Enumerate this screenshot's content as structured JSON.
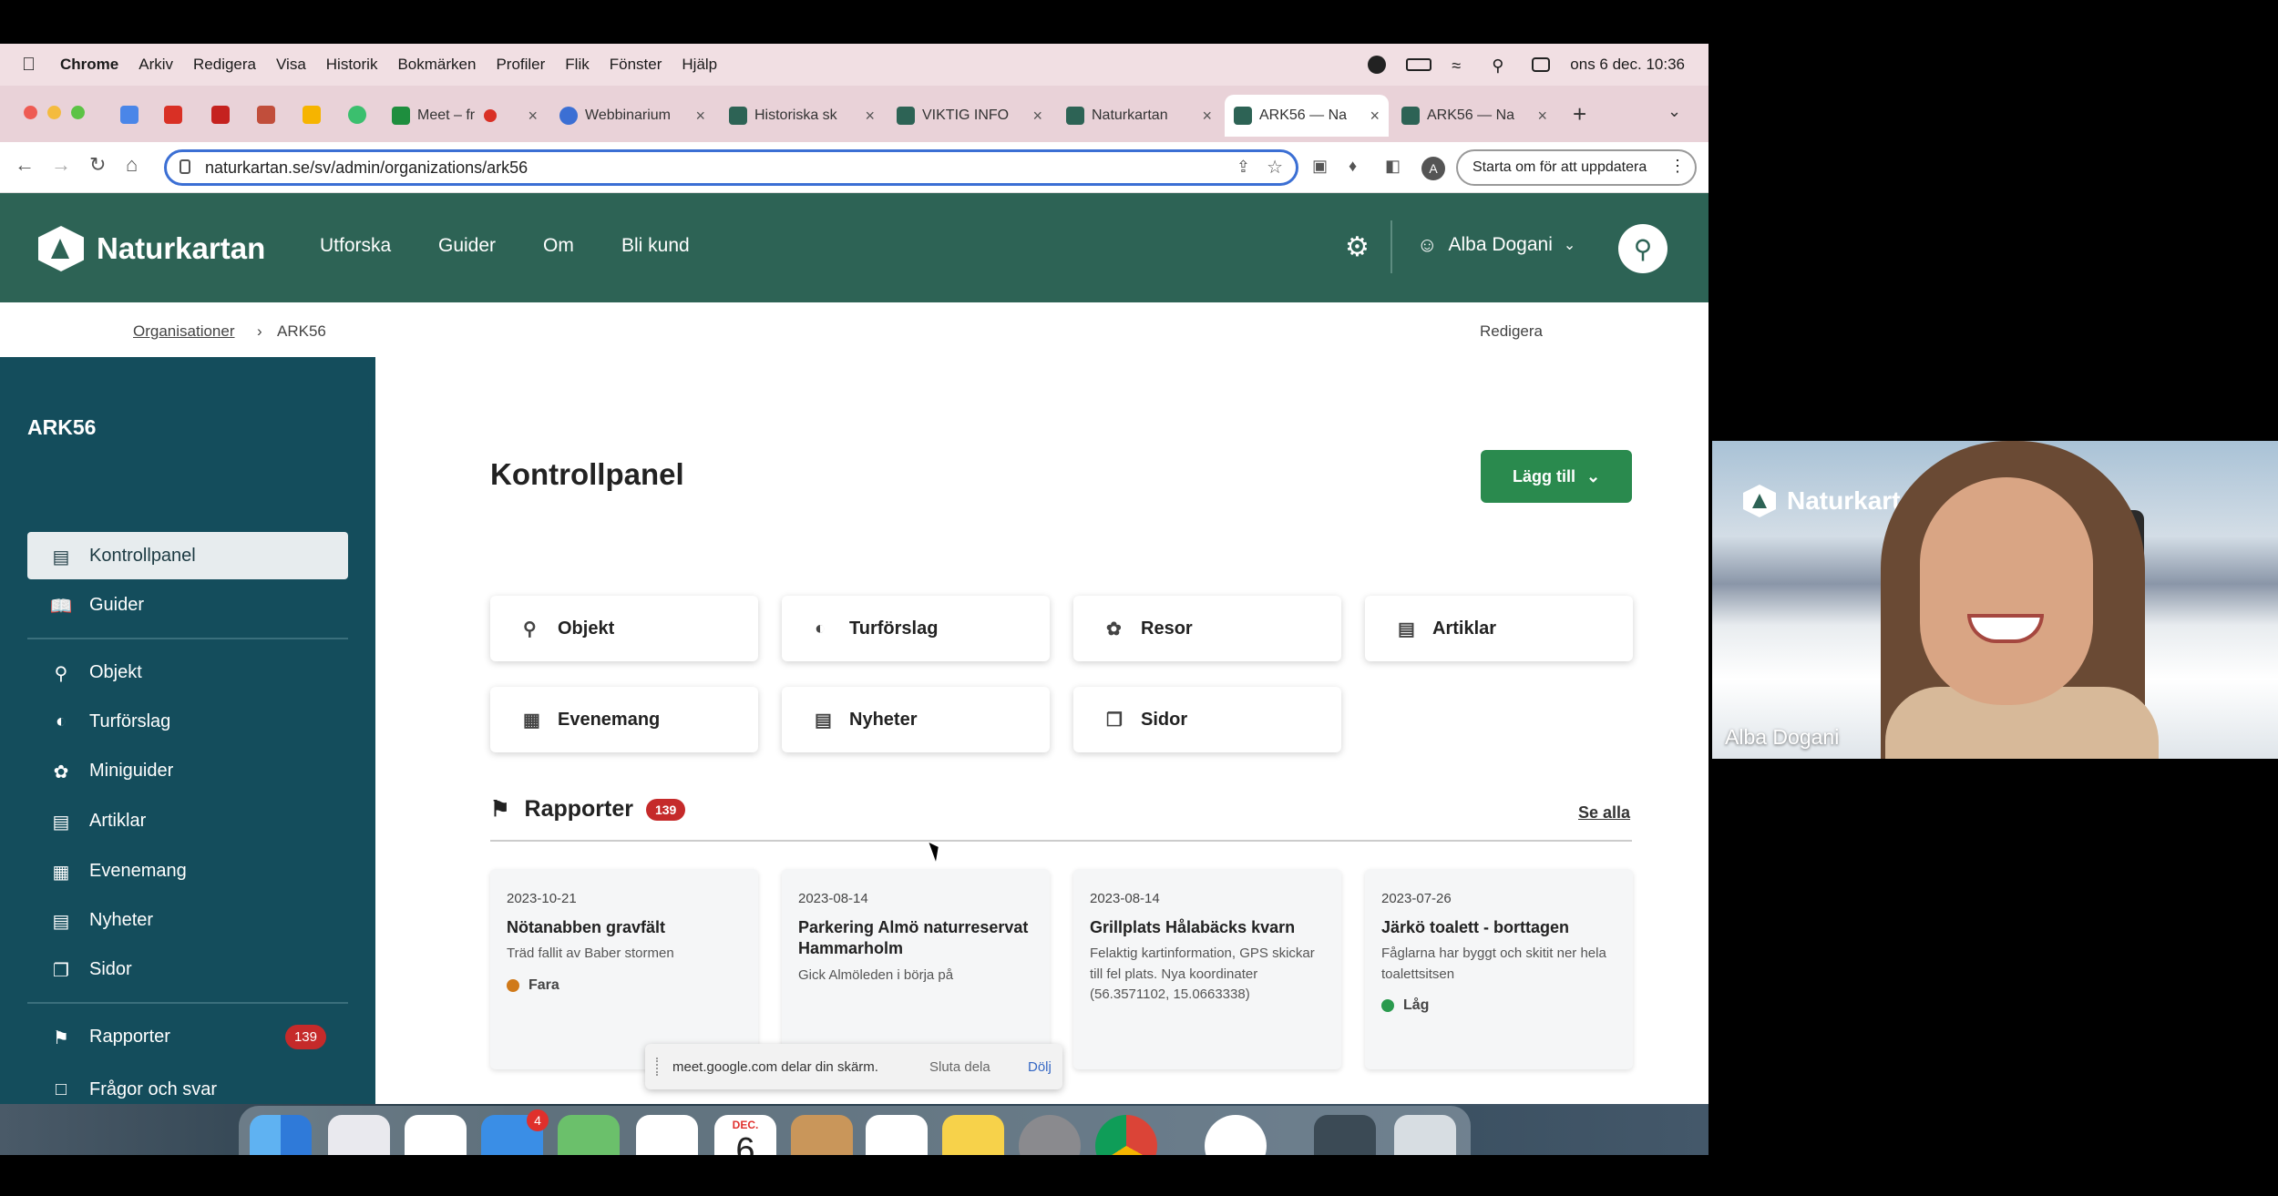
{
  "menubar": {
    "app": "Chrome",
    "items": [
      "Arkiv",
      "Redigera",
      "Visa",
      "Historik",
      "Bokmärken",
      "Profiler",
      "Flik",
      "Fönster",
      "Hjälp"
    ],
    "datetime": "ons 6 dec. 10:36"
  },
  "tabs": [
    {
      "label": "Meet – fr",
      "color": "#1e8e3e"
    },
    {
      "label": "Webbinarium",
      "color": "#3b6fd4"
    },
    {
      "label": "Historiska sk",
      "color": "#2d6355"
    },
    {
      "label": "VIKTIG INFO",
      "color": "#2d6355"
    },
    {
      "label": "Naturkartan",
      "color": "#2d6355"
    },
    {
      "label": "ARK56 — Na",
      "color": "#2d6355"
    },
    {
      "label": "ARK56 — Na",
      "color": "#2d6355"
    }
  ],
  "toolbar": {
    "url": "naturkartan.se/sv/admin/organizations/ark56",
    "update_label": "Starta om för att uppdatera"
  },
  "site": {
    "logo": "Naturkartan",
    "nav": [
      "Utforska",
      "Guider",
      "Om",
      "Bli kund"
    ],
    "user": "Alba Dogani"
  },
  "breadcrumb": {
    "parent": "Organisationer",
    "current": "ARK56",
    "edit": "Redigera"
  },
  "sidebar": {
    "org": "ARK56",
    "items": [
      {
        "label": "Kontrollpanel",
        "icon": "dashboard-icon"
      },
      {
        "label": "Guider",
        "icon": "book-icon"
      },
      {
        "label": "Objekt",
        "icon": "location-pin-icon"
      },
      {
        "label": "Turförslag",
        "icon": "route-icon"
      },
      {
        "label": "Miniguider",
        "icon": "miniguide-icon"
      },
      {
        "label": "Artiklar",
        "icon": "document-icon"
      },
      {
        "label": "Evenemang",
        "icon": "calendar-icon"
      },
      {
        "label": "Nyheter",
        "icon": "newspaper-icon"
      },
      {
        "label": "Sidor",
        "icon": "pages-icon"
      },
      {
        "label": "Rapporter",
        "icon": "flag-icon"
      },
      {
        "label": "Frågor och svar",
        "icon": "chat-icon"
      }
    ],
    "reports_count": "139"
  },
  "main": {
    "title": "Kontrollpanel",
    "add_label": "Lägg till",
    "quick": [
      "Objekt",
      "Turförslag",
      "Resor",
      "Artiklar",
      "Evenemang",
      "Nyheter",
      "Sidor"
    ],
    "reports_title": "Rapporter",
    "reports_count": "139",
    "see_all": "Se alla",
    "reports": [
      {
        "date": "2023-10-21",
        "title": "Nötanabben gravfält",
        "desc": "Träd fallit av Baber stormen",
        "severity": "Fara",
        "severity_color": "#d07a1a"
      },
      {
        "date": "2023-08-14",
        "title": "Parkering Almö naturreservat Hammarholm",
        "desc": "Gick Almöleden i börja på",
        "severity": "",
        "severity_color": ""
      },
      {
        "date": "2023-08-14",
        "title": "Grillplats Hålabäcks kvarn",
        "desc": "Felaktig kartinformation, GPS skickar till fel plats. Nya koordinater (56.3571102, 15.0663338)",
        "severity": "",
        "severity_color": ""
      },
      {
        "date": "2023-07-26",
        "title": "Järkö toalett - borttagen",
        "desc": "Fåglarna har byggt och skitit ner hela toalettsitsen",
        "severity": "Låg",
        "severity_color": "#2a9a4e"
      }
    ]
  },
  "share": {
    "text": "meet.google.com delar din skärm.",
    "stop": "Sluta dela",
    "hide": "Dölj"
  },
  "dock": {
    "mail_badge": "4",
    "cal_month": "DEC.",
    "cal_day": "6"
  },
  "video": {
    "name": "Alba Dogani",
    "logo": "Naturkarta"
  }
}
